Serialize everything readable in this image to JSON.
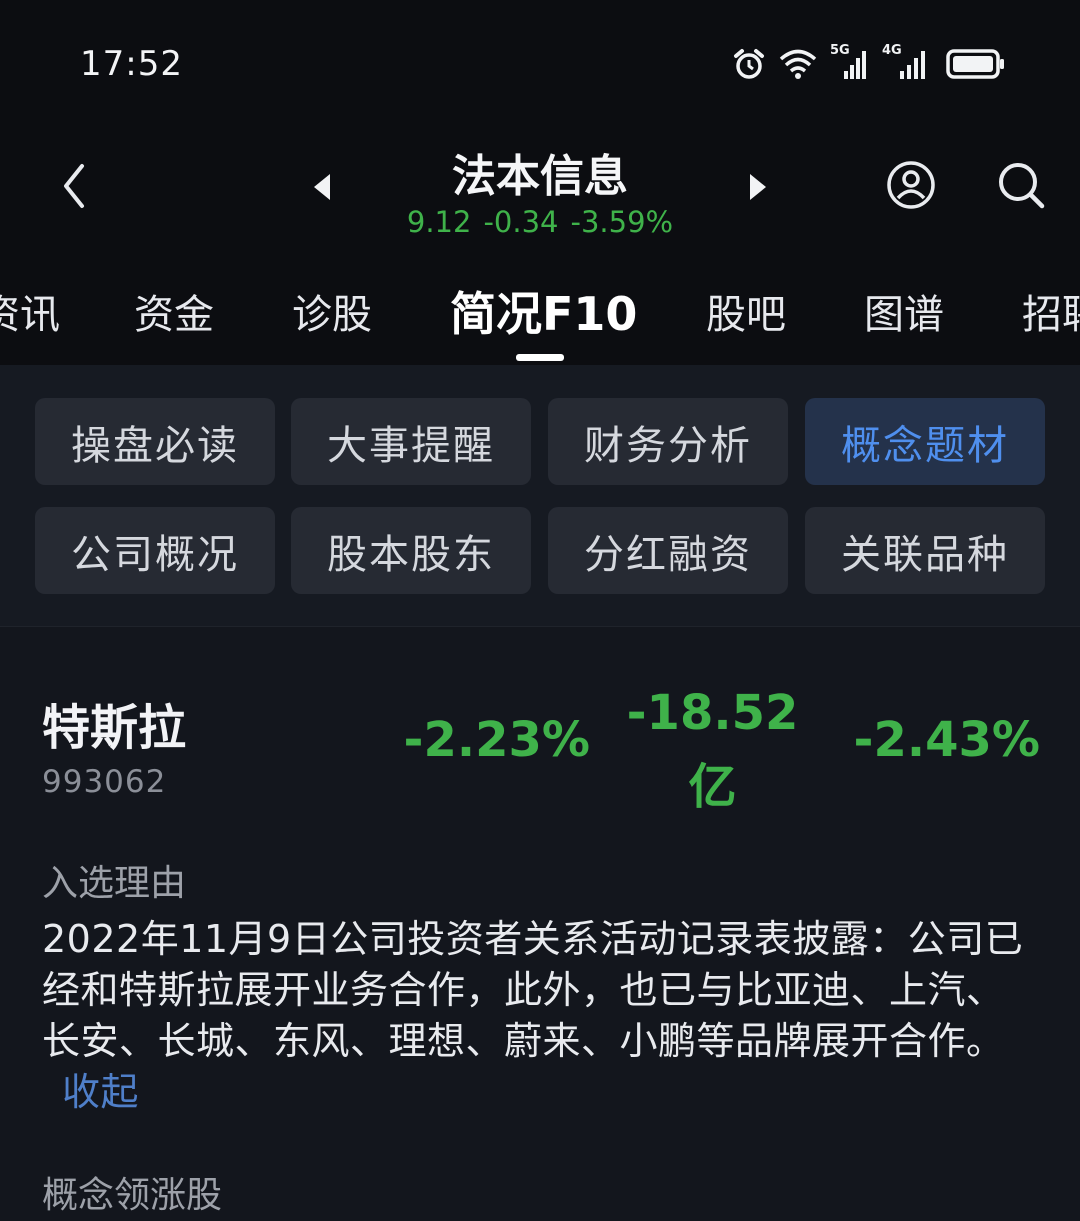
{
  "status_bar": {
    "time": "17:52",
    "icons": [
      "alarm-icon",
      "wifi-icon",
      "signal-5g-icon",
      "signal-4g-icon",
      "battery-icon"
    ],
    "net1": "5G",
    "net2": "4G"
  },
  "header": {
    "stock_name": "法本信息",
    "price": "9.12",
    "change": "-0.34",
    "change_pct": "-3.59%"
  },
  "tabs": [
    {
      "label": "资讯"
    },
    {
      "label": "资金"
    },
    {
      "label": "诊股"
    },
    {
      "label": "简况F10",
      "active": true
    },
    {
      "label": "股吧"
    },
    {
      "label": "图谱"
    },
    {
      "label": "招聘"
    }
  ],
  "sections": [
    {
      "label": "操盘必读"
    },
    {
      "label": "大事提醒"
    },
    {
      "label": "财务分析"
    },
    {
      "label": "概念题材",
      "active": true
    },
    {
      "label": "公司概况"
    },
    {
      "label": "股本股东"
    },
    {
      "label": "分红融资"
    },
    {
      "label": "关联品种"
    }
  ],
  "concept": {
    "name": "特斯拉",
    "code": "993062",
    "change_pct": "-2.23%",
    "net_flow_value": "-18.52",
    "net_flow_unit": "亿",
    "change_pct_2": "-2.43%",
    "reason_label": "入选理由",
    "reason_text": "2022年11月9日公司投资者关系活动记录表披露：公司已经和特斯拉展开业务合作，此外，也已与比亚迪、上汽、长安、长城、东风、理想、蔚来、小鹏等品牌展开合作。",
    "collapse_label": "收起",
    "leaders_label": "概念领涨股"
  },
  "colors": {
    "down_green": "#3fb24a",
    "accent_blue": "#4f8fee",
    "background": "#13161d"
  }
}
